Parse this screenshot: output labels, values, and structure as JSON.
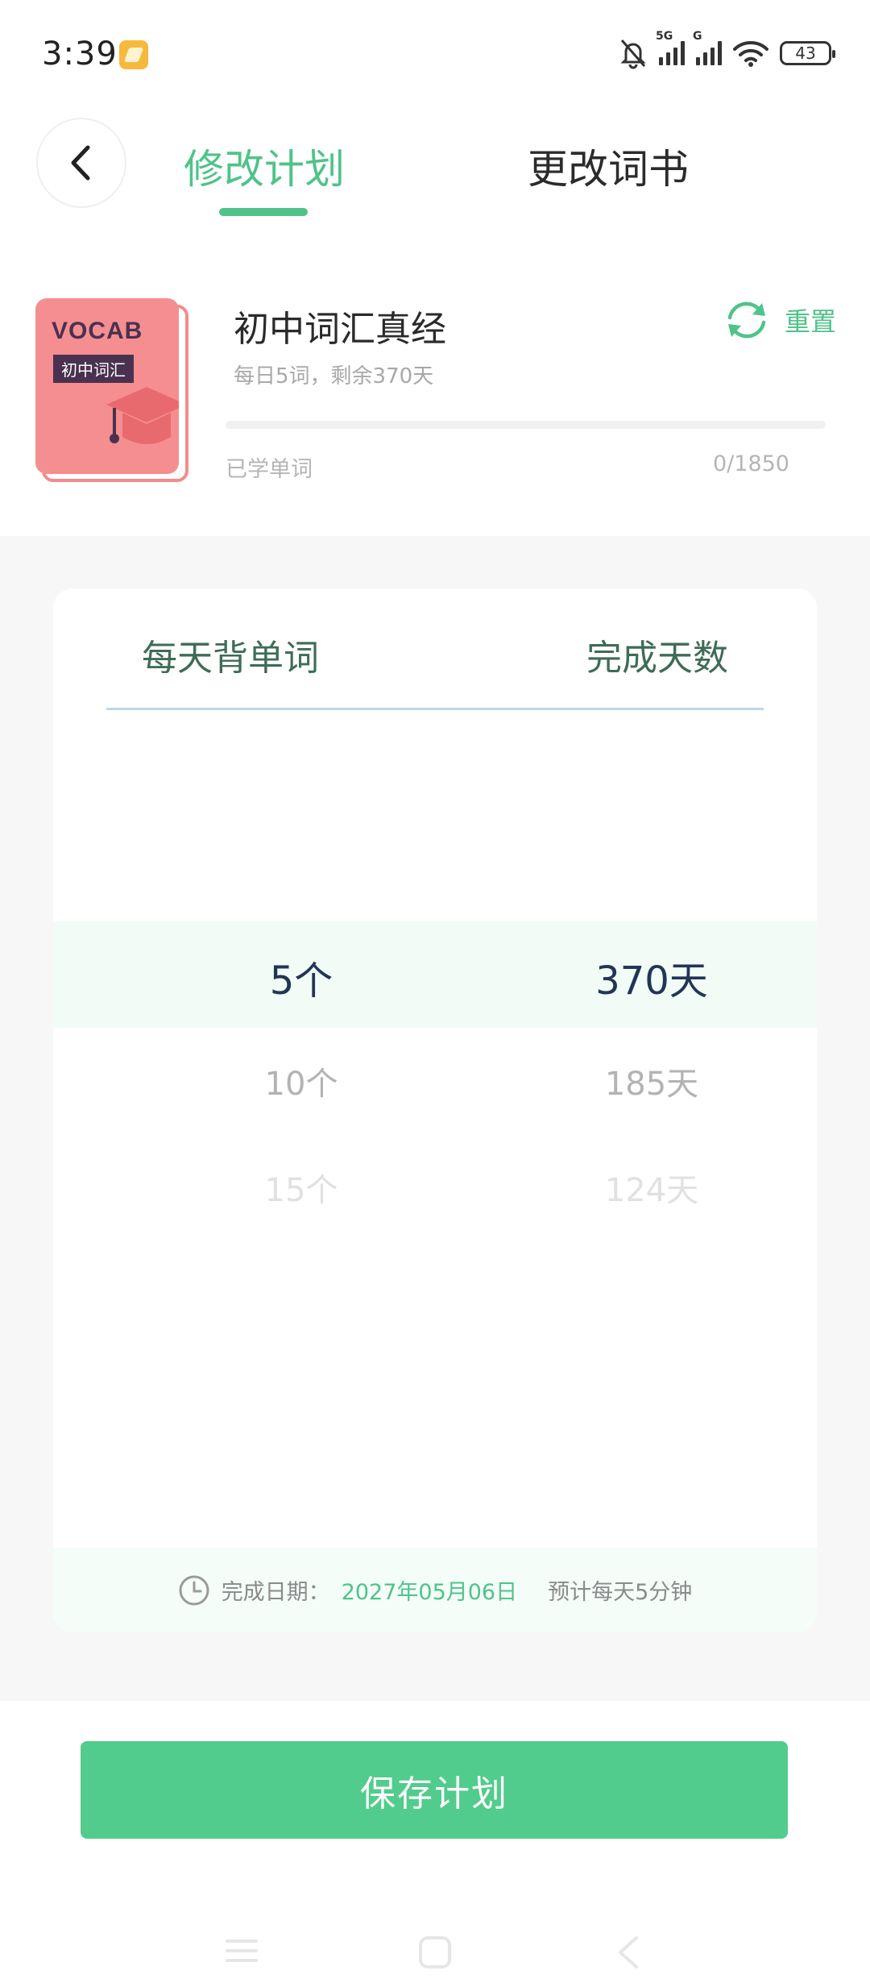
{
  "status_bar": {
    "time": "3:39",
    "network_1": "5G",
    "network_2": "G",
    "battery": "43",
    "icons": [
      "notification-app-icon",
      "bell-muted-icon",
      "signal-5g-icon",
      "signal-g-icon",
      "wifi-icon",
      "battery-icon"
    ]
  },
  "header": {
    "back_icon": "chevron-left-icon",
    "tab_modify_plan": "修改计划",
    "tab_change_book": "更改词书",
    "active_tab": "修改计划"
  },
  "book": {
    "cover_title": "VOCAB",
    "cover_subtitle": "初中词汇",
    "cover_icon": "graduation-cap-icon",
    "title": "初中词汇真经",
    "summary": "每日5词，剩余370天",
    "reset_label": "重置",
    "reset_icon": "refresh-icon",
    "learned_label": "已学单词",
    "learned_count": "0/1850",
    "progress": 0
  },
  "planner": {
    "col_words_header": "每天背单词",
    "col_days_header": "完成天数",
    "words_options": [
      "5个",
      "10个",
      "15个"
    ],
    "days_options": [
      "370天",
      "185天",
      "124天"
    ],
    "selected_index": 0,
    "footer": {
      "clock_icon": "clock-icon",
      "date_label": "完成日期：",
      "date_value": "2027年05月06日",
      "estimate": "预计每天5分钟"
    }
  },
  "save_button": "保存计划",
  "nav_bar": {
    "icons": [
      "menu-icon",
      "home-square-icon",
      "back-triangle-icon"
    ]
  },
  "colors": {
    "accent": "#4fc38a",
    "button": "#52cc8c",
    "cover": "#f58e90",
    "selected_band": "#f1fcf6"
  }
}
